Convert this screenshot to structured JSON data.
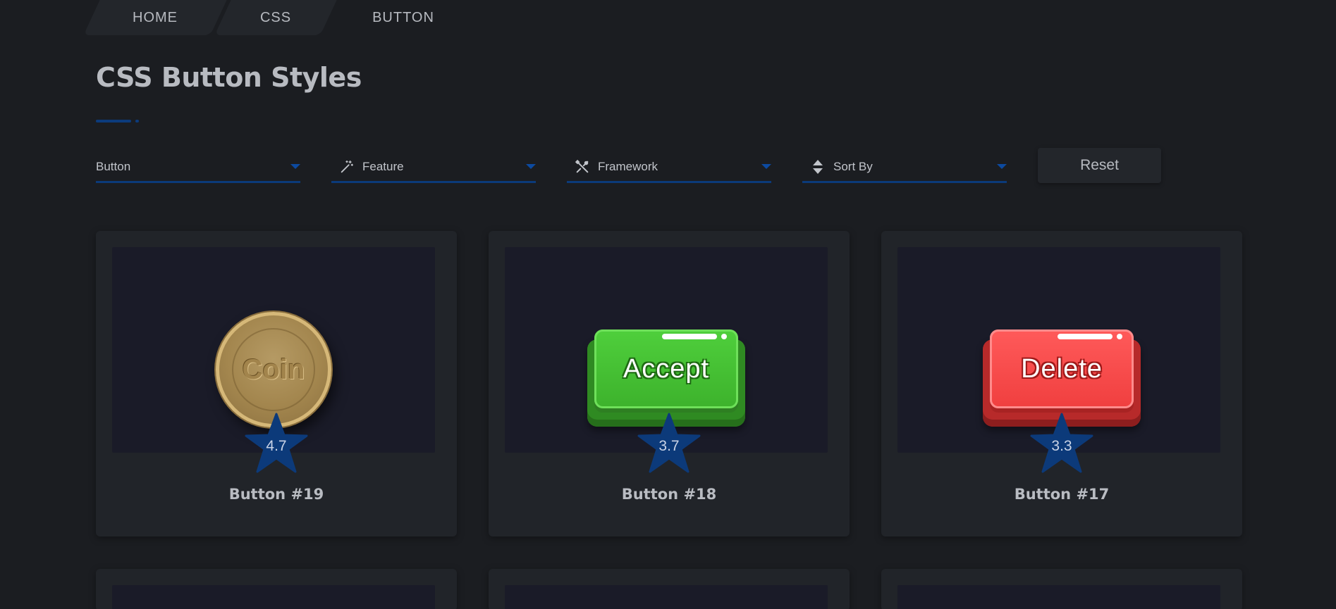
{
  "breadcrumb": {
    "items": [
      {
        "label": "HOME"
      },
      {
        "label": "CSS"
      },
      {
        "label": "BUTTON"
      }
    ]
  },
  "page": {
    "title": "CSS Button Styles"
  },
  "filters": {
    "button": {
      "label": "Button"
    },
    "feature": {
      "label": "Feature",
      "icon": "magic-wand-icon"
    },
    "framework": {
      "label": "Framework",
      "icon": "tools-icon"
    },
    "sort": {
      "label": "Sort By",
      "icon": "sort-icon"
    },
    "reset_label": "Reset"
  },
  "cards": [
    {
      "name": "Button #19",
      "rating": "4.7",
      "preview_label": "Coin"
    },
    {
      "name": "Button #18",
      "rating": "3.7",
      "preview_label": "Accept"
    },
    {
      "name": "Button #17",
      "rating": "3.3",
      "preview_label": "Delete"
    }
  ],
  "colors": {
    "background": "#1b1d21",
    "card": "#212429",
    "accent": "#0c3b7c",
    "star": "#0c3a7a"
  }
}
